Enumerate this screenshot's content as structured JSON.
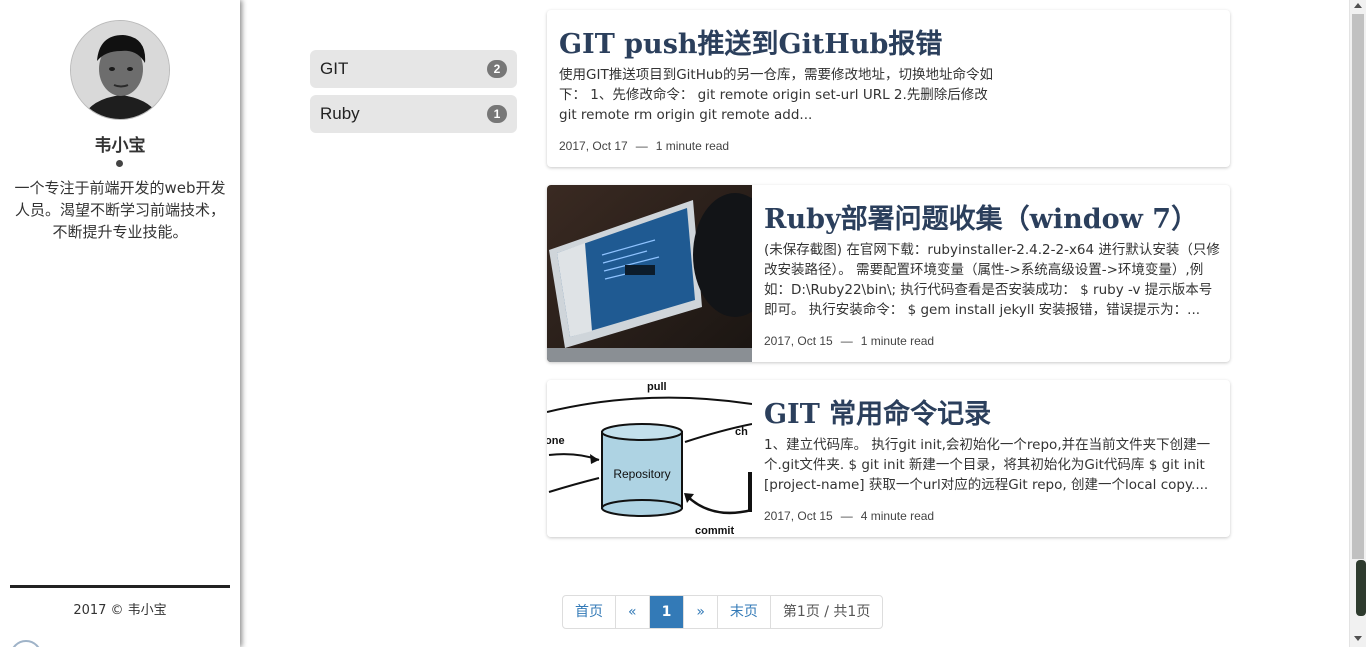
{
  "sidebar": {
    "author_name": "韦小宝",
    "author_description": "一个专注于前端开发的web开发人员。渴望不断学习前端技术，不断提升专业技能。",
    "copyright": "2017 © 韦小宝"
  },
  "tags": [
    {
      "label": "GIT",
      "count": "2"
    },
    {
      "label": "Ruby",
      "count": "1"
    }
  ],
  "posts": [
    {
      "title": "GIT push推送到GitHub报错",
      "excerpt": "使用GIT推送项目到GitHub的另一仓库，需要修改地址，切换地址命令如下： 1、先修改命令： git remote origin set-url URL 2.先删除后修改 git remote rm origin git remote add...",
      "date": "2017, Oct 17",
      "separator": "—",
      "read_time": "1 minute read"
    },
    {
      "title": "Ruby部署问题收集（window 7）",
      "excerpt": "(未保存截图) 在官网下载：rubyinstaller-2.4.2-2-x64 进行默认安装（只修改安装路径）。 需要配置环境变量（属性->系统高级设置->环境变量）,例如：D:\\Ruby22\\bin\\; 执行代码查看是否安装成功： $ ruby -v 提示版本号即可。 执行安装命令： $ gem install jekyll 安装报错，错误提示为：...",
      "date": "2017, Oct 15",
      "separator": "—",
      "read_time": "1 minute read"
    },
    {
      "title": "GIT 常用命令记录",
      "excerpt": "1、建立代码库。 执行git init,会初始化一个repo,并在当前文件夹下创建一个.git文件夹. $ git init 新建一个目录，将其初始化为Git代码库 $ git init [project-name] 获取一个url对应的远程Git repo, 创建一个local copy....",
      "date": "2017, Oct 15",
      "separator": "—",
      "read_time": "4 minute read",
      "thumb_labels": {
        "pull": "pull",
        "left": "one",
        "right": "ch",
        "repository": "Repository",
        "commit": "commit"
      }
    }
  ],
  "pagination": {
    "first": "首页",
    "prev": "«",
    "current": "1",
    "next": "»",
    "last": "末页",
    "info": "第1页 / 共1页"
  },
  "colors": {
    "link": "#337ab7",
    "title": "#2b3f5c",
    "tag_bg": "#e6e6e6",
    "badge": "#777777"
  }
}
